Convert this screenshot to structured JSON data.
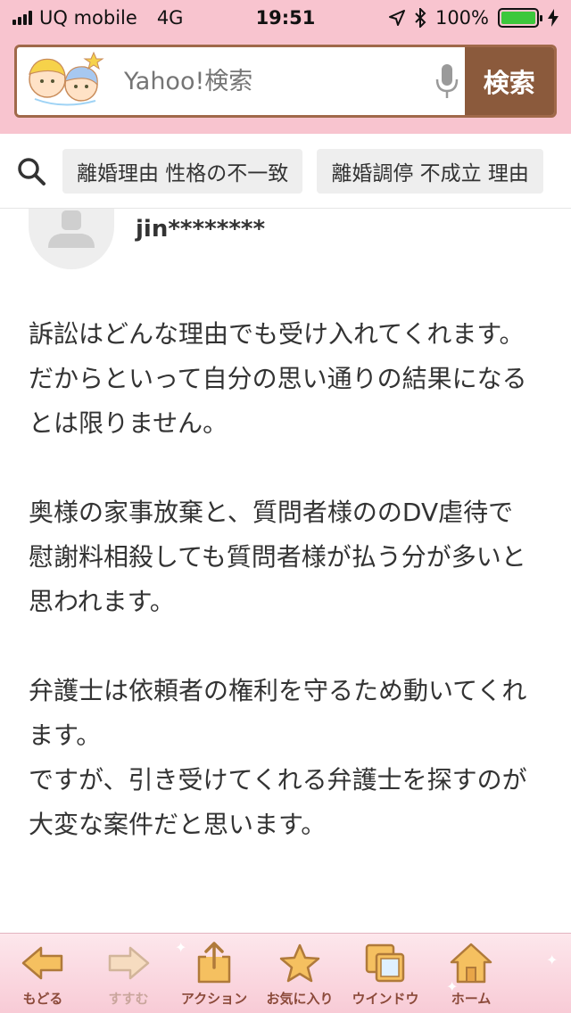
{
  "status": {
    "carrier": "UQ mobile",
    "network": "4G",
    "time": "19:51",
    "battery": "100%",
    "battery_level": 1.0
  },
  "search": {
    "placeholder": "Yahoo!検索",
    "button_label": "検索"
  },
  "suggestions": [
    "離婚理由 性格の不一致",
    "離婚調停 不成立 理由"
  ],
  "answer": {
    "username": "jin********",
    "paragraphs": [
      "訴訟はどんな理由でも受け入れてくれます。\nだからといって自分の思い通りの結果になるとは限りません。",
      "奥様の家事放棄と、質問者様ののDV虐待で\n慰謝料相殺しても質問者様が払う分が多いと思われます。",
      "弁護士は依頼者の権利を守るため動いてくれます。\nですが、引き受けてくれる弁護士を探すのが大変な案件だと思います。"
    ]
  },
  "toolbar": {
    "back": "もどる",
    "forward": "すすむ",
    "action": "アクション",
    "favorites": "お気に入り",
    "window": "ウインドウ",
    "home": "ホーム"
  },
  "colors": {
    "header_pink": "#f8c4cf",
    "search_brown": "#8b5a3c",
    "toolbar_icon": "#f5c060"
  }
}
